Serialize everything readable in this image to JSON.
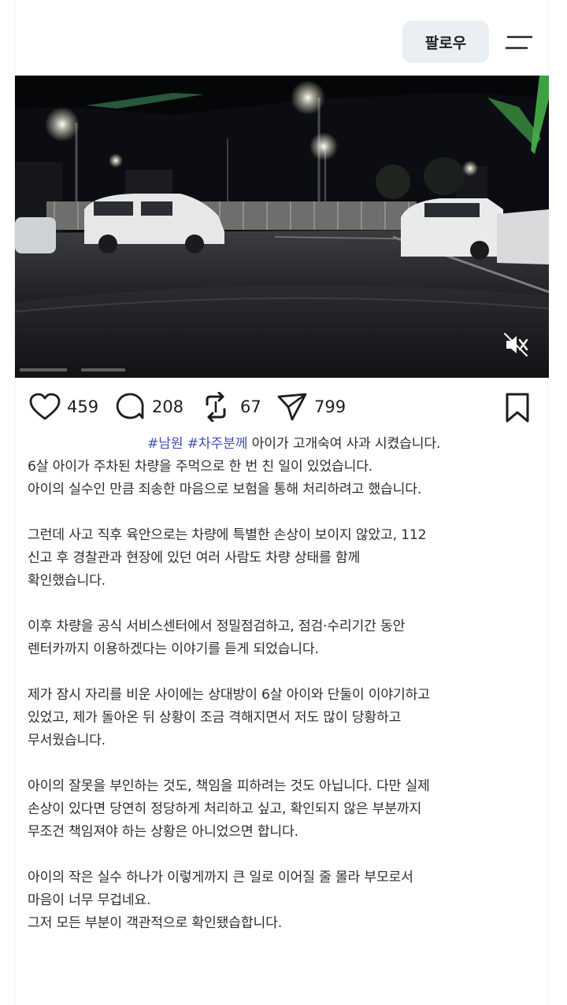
{
  "header": {
    "follow_label": "팔로우",
    "menu_icon": "menu-icon"
  },
  "video": {
    "mute_icon": "mute-icon"
  },
  "actions": {
    "likes": "459",
    "comments": "208",
    "reposts": "67",
    "shares": "799",
    "icons": [
      "heart-icon",
      "comment-icon",
      "repost-icon",
      "send-icon",
      "bookmark-icon"
    ]
  },
  "caption": {
    "hashtag1": "#남원",
    "hashtag2": "#차주분께",
    "intro": "아이가 고개숙여 사과 시켰습니다.",
    "p1_lines": [
      "6살 아이가 주차된 차량을 주먹으로 한 번 친 일이 있었습니다.",
      "아이의 실수인 만큼 죄송한 마음으로 보험을 통해 처리하려고 했습니다."
    ],
    "p2_lines": [
      "그런데 사고 직후 육안으로는 차량에 특별한 손상이 보이지 않았고, 112",
      "신고 후 경찰관과 현장에 있던 여러 사람도 차량 상태를 함께",
      "확인했습니다."
    ],
    "p3_lines": [
      "이후 차량을 공식 서비스센터에서 정밀점검하고, 점검·수리기간 동안",
      "렌터카까지 이용하겠다는 이야기를 듣게 되었습니다."
    ],
    "p4_lines": [
      "제가 잠시 자리를 비운 사이에는 상대방이 6살 아이와 단둘이 이야기하고",
      "있었고, 제가 돌아온 뒤 상황이 조금 격해지면서 저도 많이 당황하고",
      "무서웠습니다."
    ],
    "p5_lines": [
      "아이의 잘못을 부인하는 것도, 책임을 피하려는 것도 아닙니다. 다만 실제",
      "손상이 있다면 당연히 정당하게 처리하고 싶고, 확인되지 않은 부분까지",
      "무조건 책임져야 하는 상황은 아니었으면 합니다."
    ],
    "p6_lines": [
      "아이의 작은 실수 하나가 이렇게까지 큰 일로 이어질 줄 몰라 부모로서",
      "마음이 너무 무겁네요.",
      "그저 모든 부분이 객관적으로 확인됐습합니다."
    ]
  }
}
